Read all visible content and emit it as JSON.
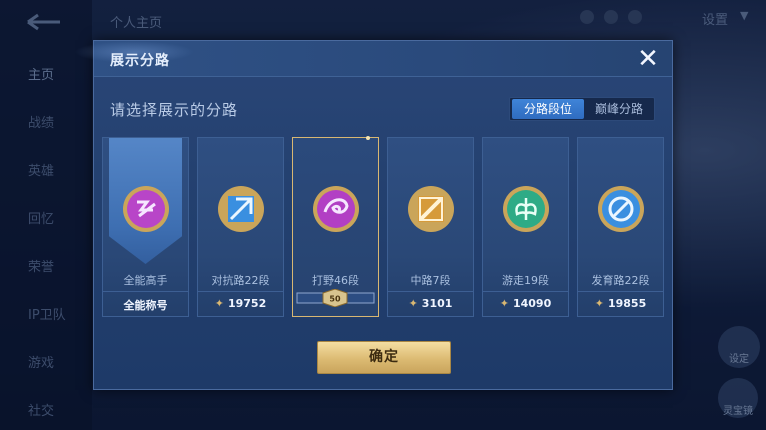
{
  "background": {
    "top_title": "个人主页",
    "settings_label": "设置",
    "nav_items": [
      {
        "label": "主页",
        "active": true
      },
      {
        "label": "战绩",
        "active": false
      },
      {
        "label": "英雄",
        "active": false
      },
      {
        "label": "回忆",
        "active": false
      },
      {
        "label": "荣誉",
        "active": false
      },
      {
        "label": "IP卫队",
        "active": false
      },
      {
        "label": "游戏",
        "active": false
      },
      {
        "label": "社交",
        "active": false
      }
    ],
    "right_buttons": [
      "设定",
      "灵宝镜"
    ]
  },
  "dialog": {
    "title": "展示分路",
    "close_icon": "close-icon",
    "subtitle": "请选择展示的分路",
    "segment": {
      "options": [
        "分路段位",
        "巅峰分路"
      ],
      "selected": "分路段位"
    },
    "cards": [
      {
        "name": "全能高手",
        "score": "全能称号",
        "badge_color": "#b845c8",
        "selected": false,
        "highlight": true
      },
      {
        "name": "对抗路22段",
        "score": "19752",
        "badge_color": "#3a8fe0",
        "selected": false
      },
      {
        "name": "打野46段",
        "score": "",
        "badge_color": "#b23fc4",
        "selected": true,
        "star_level": "50"
      },
      {
        "name": "中路7段",
        "score": "3101",
        "badge_color": "#d69a3a",
        "selected": false
      },
      {
        "name": "游走19段",
        "score": "14090",
        "badge_color": "#2eab86",
        "selected": false
      },
      {
        "name": "发育路22段",
        "score": "19855",
        "badge_color": "#3a8fe0",
        "selected": false
      }
    ],
    "confirm_label": "确定"
  },
  "colors": {
    "accent_gold": "#d8b772",
    "selected_tab": "#3f84d8",
    "dialog_bg": "#23406f"
  }
}
